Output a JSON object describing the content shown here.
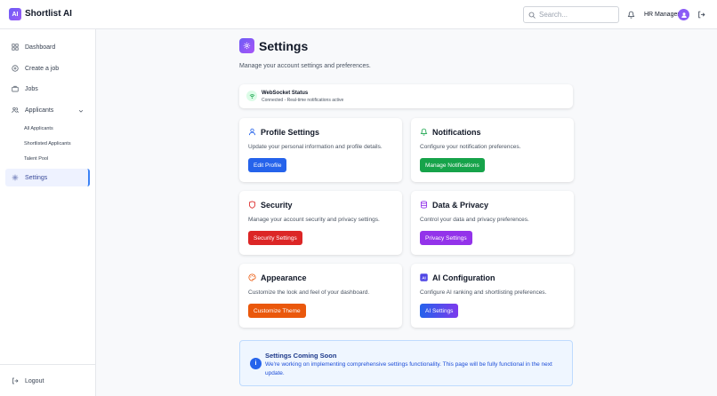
{
  "app": {
    "logo_text": "AI",
    "brand": "Shortlist AI"
  },
  "header": {
    "search_placeholder": "Search...",
    "user_name": "HR Manager"
  },
  "sidebar": {
    "items": [
      {
        "label": "Dashboard",
        "icon": "grid-icon"
      },
      {
        "label": "Create a job",
        "icon": "plus-circle-icon"
      },
      {
        "label": "Jobs",
        "icon": "briefcase-icon"
      },
      {
        "label": "Applicants",
        "icon": "users-icon"
      },
      {
        "label": "Settings",
        "icon": "gear-icon"
      }
    ],
    "sub_items": [
      "All Applicants",
      "Shortlisted Applicants",
      "Talent Pool"
    ],
    "logout": "Logout"
  },
  "main": {
    "title": "Settings",
    "subtitle": "Manage your account settings and preferences.",
    "websocket": {
      "title": "WebSocket Status",
      "status": "Connected - Real-time notifications active"
    },
    "cards": [
      {
        "title": "Profile Settings",
        "desc": "Update your personal information and profile details.",
        "button": "Edit Profile",
        "color": "#2563eb"
      },
      {
        "title": "Notifications",
        "desc": "Configure your notification preferences.",
        "button": "Manage Notifications",
        "color": "#16a34a"
      },
      {
        "title": "Security",
        "desc": "Manage your account security and privacy settings.",
        "button": "Security Settings",
        "color": "#dc2626"
      },
      {
        "title": "Data & Privacy",
        "desc": "Control your data and privacy preferences.",
        "button": "Privacy Settings",
        "color": "#9333ea"
      },
      {
        "title": "Appearance",
        "desc": "Customize the look and feel of your dashboard.",
        "button": "Customize Theme",
        "color": "#ea580c"
      },
      {
        "title": "AI Configuration",
        "desc": "Configure AI ranking and shortlisting preferences.",
        "button": "AI Settings",
        "color": "#4f46e5"
      }
    ],
    "info": {
      "icon_text": "i",
      "title": "Settings Coming Soon",
      "text": "We're working on implementing comprehensive settings functionality. This page will be fully functional in the next update."
    }
  }
}
